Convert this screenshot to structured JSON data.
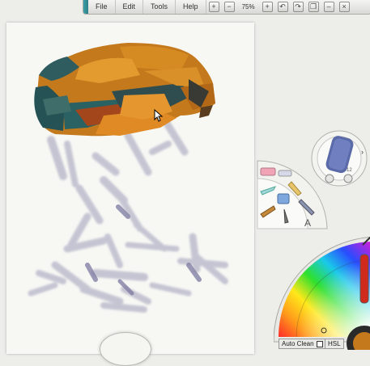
{
  "menubar": {
    "items": [
      "File",
      "Edit",
      "Tools",
      "Help"
    ],
    "zoom": "75%"
  },
  "color_panel": {
    "auto_clean": "Auto Clean",
    "mode": "HSL"
  },
  "colors": {
    "orange": "#d4861f",
    "teal": "#2e5f62",
    "purple_stroke": "#8a88a8"
  }
}
